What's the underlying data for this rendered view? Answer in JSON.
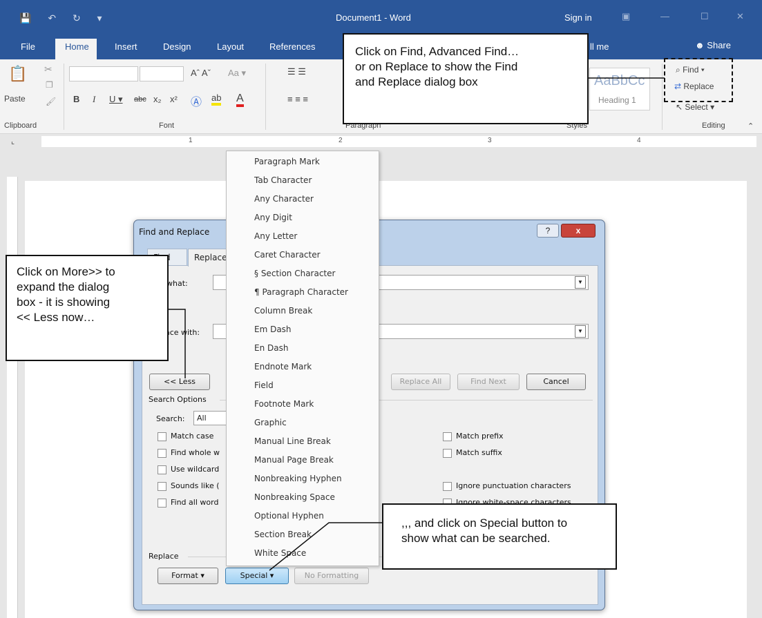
{
  "titlebar": {
    "doc_title": "Document1 - Word",
    "signin": "Sign in"
  },
  "tabs": {
    "file": "File",
    "home": "Home",
    "insert": "Insert",
    "design": "Design",
    "layout": "Layout",
    "references": "References",
    "tell_me_fragment": "ll me",
    "share": "Share"
  },
  "ribbon": {
    "clipboard": "Clipboard",
    "font": "Font",
    "paragraph": "Paragraph",
    "styles": "Styles",
    "editing": "Editing",
    "paste": "Paste",
    "style_preview": "AaBbCc",
    "style_name": "Heading 1",
    "find": "Find",
    "replace": "Replace",
    "select": "Select"
  },
  "ruler": {
    "marks": [
      "1",
      "2",
      "3",
      "4"
    ]
  },
  "dialog": {
    "title": "Find and Replace",
    "help": "?",
    "close": "x",
    "tab_find": "Find",
    "tab_replace": "Replace",
    "find_what_label": "Find what:",
    "replace_with_label": "Replace with:",
    "less_button": "<< Less",
    "replace_all_button": "Replace All",
    "find_next_button": "Find Next",
    "cancel_button": "Cancel",
    "search_options": "Search Options",
    "search_label": "Search:",
    "search_value": "All",
    "options": {
      "match_case": "Match case",
      "find_whole": "Find whole w",
      "use_wildcard": "Use wildcard",
      "sounds_like": "Sounds like (",
      "find_all_word": "Find all word",
      "match_prefix": "Match prefix",
      "match_suffix": "Match suffix",
      "ignore_punct": "Ignore punctuation characters",
      "ignore_space": "Ignore white-space characters"
    },
    "replace_section": "Replace",
    "format_button": "Format",
    "special_button": "Special",
    "no_formatting_button": "No Formatting"
  },
  "special_menu": [
    "Paragraph Mark",
    "Tab Character",
    "Any Character",
    "Any Digit",
    "Any Letter",
    "Caret Character",
    "§ Section Character",
    "¶ Paragraph Character",
    "Column Break",
    "Em Dash",
    "En Dash",
    "Endnote Mark",
    "Field",
    "Footnote Mark",
    "Graphic",
    "Manual Line Break",
    "Manual Page Break",
    "Nonbreaking Hyphen",
    "Nonbreaking Space",
    "Optional Hyphen",
    "Section Break",
    "White Space"
  ],
  "callouts": {
    "top": [
      "Click on Find, Advanced Find…",
      "or on Replace to show the Find",
      "and Replace dialog box"
    ],
    "left": [
      "Click on More>> to",
      "expand the dialog",
      "box - it is showing",
      "<< Less now…"
    ],
    "bottom": [
      ",,, and click on Special button to",
      "show what can be searched."
    ]
  }
}
